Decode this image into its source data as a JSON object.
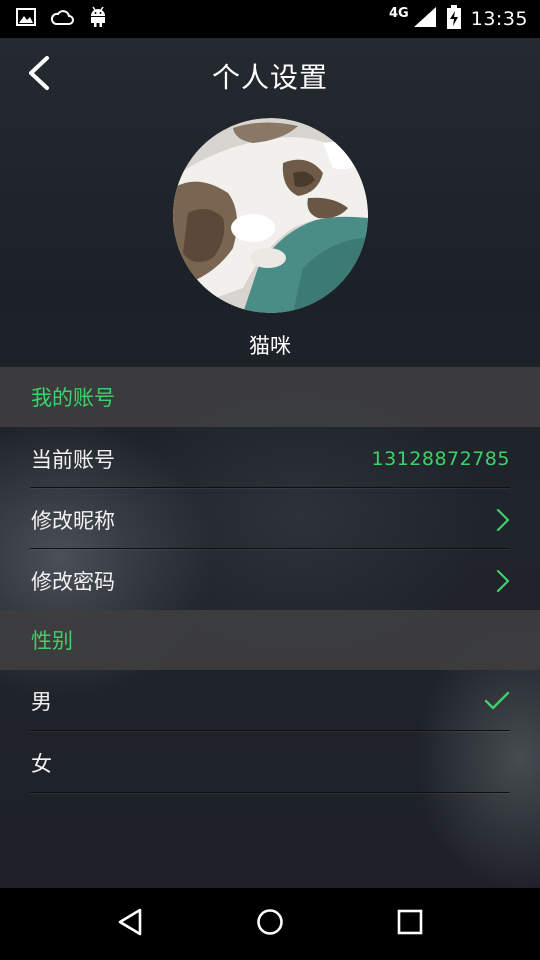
{
  "status_bar": {
    "network": "4G",
    "time": "13:35",
    "icons": [
      "image-icon",
      "cloud-icon",
      "android-icon",
      "signal-icon",
      "battery-charging-icon"
    ]
  },
  "header": {
    "title": "个人设置",
    "back_icon": "back-arrow-icon"
  },
  "profile": {
    "nickname": "猫咪",
    "avatar_icon": "cat-avatar"
  },
  "account_section": {
    "header": "我的账号",
    "rows": [
      {
        "label": "当前账号",
        "value": "13128872785"
      },
      {
        "label": "修改昵称"
      },
      {
        "label": "修改密码"
      }
    ]
  },
  "gender_section": {
    "header": "性别",
    "options": [
      {
        "label": "男",
        "selected": true
      },
      {
        "label": "女",
        "selected": false
      }
    ]
  },
  "colors": {
    "accent": "#3fd06a",
    "section_bg": "#3e3e40",
    "background": "#1f242a"
  },
  "nav_bar": {
    "icons": [
      "back-triangle-icon",
      "home-circle-icon",
      "recents-square-icon"
    ]
  }
}
